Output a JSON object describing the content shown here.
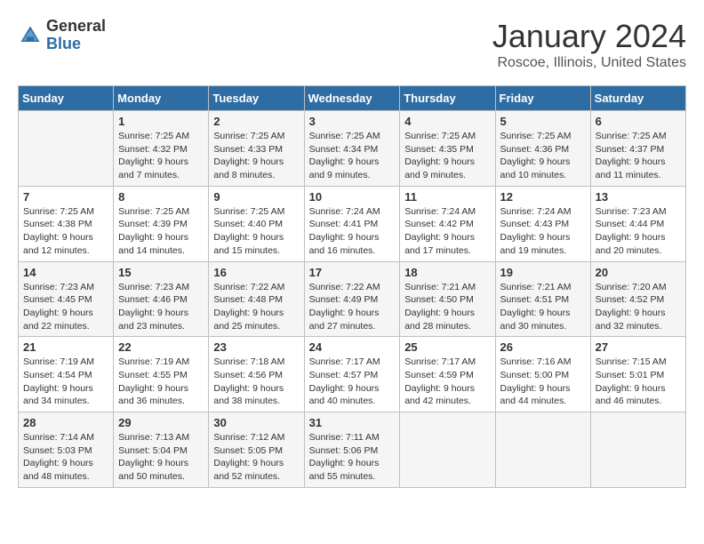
{
  "header": {
    "logo_general": "General",
    "logo_blue": "Blue",
    "title": "January 2024",
    "location": "Roscoe, Illinois, United States"
  },
  "days_of_week": [
    "Sunday",
    "Monday",
    "Tuesday",
    "Wednesday",
    "Thursday",
    "Friday",
    "Saturday"
  ],
  "weeks": [
    [
      {
        "num": "",
        "sunrise": "",
        "sunset": "",
        "daylight": ""
      },
      {
        "num": "1",
        "sunrise": "Sunrise: 7:25 AM",
        "sunset": "Sunset: 4:32 PM",
        "daylight": "Daylight: 9 hours and 7 minutes."
      },
      {
        "num": "2",
        "sunrise": "Sunrise: 7:25 AM",
        "sunset": "Sunset: 4:33 PM",
        "daylight": "Daylight: 9 hours and 8 minutes."
      },
      {
        "num": "3",
        "sunrise": "Sunrise: 7:25 AM",
        "sunset": "Sunset: 4:34 PM",
        "daylight": "Daylight: 9 hours and 9 minutes."
      },
      {
        "num": "4",
        "sunrise": "Sunrise: 7:25 AM",
        "sunset": "Sunset: 4:35 PM",
        "daylight": "Daylight: 9 hours and 9 minutes."
      },
      {
        "num": "5",
        "sunrise": "Sunrise: 7:25 AM",
        "sunset": "Sunset: 4:36 PM",
        "daylight": "Daylight: 9 hours and 10 minutes."
      },
      {
        "num": "6",
        "sunrise": "Sunrise: 7:25 AM",
        "sunset": "Sunset: 4:37 PM",
        "daylight": "Daylight: 9 hours and 11 minutes."
      }
    ],
    [
      {
        "num": "7",
        "sunrise": "Sunrise: 7:25 AM",
        "sunset": "Sunset: 4:38 PM",
        "daylight": "Daylight: 9 hours and 12 minutes."
      },
      {
        "num": "8",
        "sunrise": "Sunrise: 7:25 AM",
        "sunset": "Sunset: 4:39 PM",
        "daylight": "Daylight: 9 hours and 14 minutes."
      },
      {
        "num": "9",
        "sunrise": "Sunrise: 7:25 AM",
        "sunset": "Sunset: 4:40 PM",
        "daylight": "Daylight: 9 hours and 15 minutes."
      },
      {
        "num": "10",
        "sunrise": "Sunrise: 7:24 AM",
        "sunset": "Sunset: 4:41 PM",
        "daylight": "Daylight: 9 hours and 16 minutes."
      },
      {
        "num": "11",
        "sunrise": "Sunrise: 7:24 AM",
        "sunset": "Sunset: 4:42 PM",
        "daylight": "Daylight: 9 hours and 17 minutes."
      },
      {
        "num": "12",
        "sunrise": "Sunrise: 7:24 AM",
        "sunset": "Sunset: 4:43 PM",
        "daylight": "Daylight: 9 hours and 19 minutes."
      },
      {
        "num": "13",
        "sunrise": "Sunrise: 7:23 AM",
        "sunset": "Sunset: 4:44 PM",
        "daylight": "Daylight: 9 hours and 20 minutes."
      }
    ],
    [
      {
        "num": "14",
        "sunrise": "Sunrise: 7:23 AM",
        "sunset": "Sunset: 4:45 PM",
        "daylight": "Daylight: 9 hours and 22 minutes."
      },
      {
        "num": "15",
        "sunrise": "Sunrise: 7:23 AM",
        "sunset": "Sunset: 4:46 PM",
        "daylight": "Daylight: 9 hours and 23 minutes."
      },
      {
        "num": "16",
        "sunrise": "Sunrise: 7:22 AM",
        "sunset": "Sunset: 4:48 PM",
        "daylight": "Daylight: 9 hours and 25 minutes."
      },
      {
        "num": "17",
        "sunrise": "Sunrise: 7:22 AM",
        "sunset": "Sunset: 4:49 PM",
        "daylight": "Daylight: 9 hours and 27 minutes."
      },
      {
        "num": "18",
        "sunrise": "Sunrise: 7:21 AM",
        "sunset": "Sunset: 4:50 PM",
        "daylight": "Daylight: 9 hours and 28 minutes."
      },
      {
        "num": "19",
        "sunrise": "Sunrise: 7:21 AM",
        "sunset": "Sunset: 4:51 PM",
        "daylight": "Daylight: 9 hours and 30 minutes."
      },
      {
        "num": "20",
        "sunrise": "Sunrise: 7:20 AM",
        "sunset": "Sunset: 4:52 PM",
        "daylight": "Daylight: 9 hours and 32 minutes."
      }
    ],
    [
      {
        "num": "21",
        "sunrise": "Sunrise: 7:19 AM",
        "sunset": "Sunset: 4:54 PM",
        "daylight": "Daylight: 9 hours and 34 minutes."
      },
      {
        "num": "22",
        "sunrise": "Sunrise: 7:19 AM",
        "sunset": "Sunset: 4:55 PM",
        "daylight": "Daylight: 9 hours and 36 minutes."
      },
      {
        "num": "23",
        "sunrise": "Sunrise: 7:18 AM",
        "sunset": "Sunset: 4:56 PM",
        "daylight": "Daylight: 9 hours and 38 minutes."
      },
      {
        "num": "24",
        "sunrise": "Sunrise: 7:17 AM",
        "sunset": "Sunset: 4:57 PM",
        "daylight": "Daylight: 9 hours and 40 minutes."
      },
      {
        "num": "25",
        "sunrise": "Sunrise: 7:17 AM",
        "sunset": "Sunset: 4:59 PM",
        "daylight": "Daylight: 9 hours and 42 minutes."
      },
      {
        "num": "26",
        "sunrise": "Sunrise: 7:16 AM",
        "sunset": "Sunset: 5:00 PM",
        "daylight": "Daylight: 9 hours and 44 minutes."
      },
      {
        "num": "27",
        "sunrise": "Sunrise: 7:15 AM",
        "sunset": "Sunset: 5:01 PM",
        "daylight": "Daylight: 9 hours and 46 minutes."
      }
    ],
    [
      {
        "num": "28",
        "sunrise": "Sunrise: 7:14 AM",
        "sunset": "Sunset: 5:03 PM",
        "daylight": "Daylight: 9 hours and 48 minutes."
      },
      {
        "num": "29",
        "sunrise": "Sunrise: 7:13 AM",
        "sunset": "Sunset: 5:04 PM",
        "daylight": "Daylight: 9 hours and 50 minutes."
      },
      {
        "num": "30",
        "sunrise": "Sunrise: 7:12 AM",
        "sunset": "Sunset: 5:05 PM",
        "daylight": "Daylight: 9 hours and 52 minutes."
      },
      {
        "num": "31",
        "sunrise": "Sunrise: 7:11 AM",
        "sunset": "Sunset: 5:06 PM",
        "daylight": "Daylight: 9 hours and 55 minutes."
      },
      {
        "num": "",
        "sunrise": "",
        "sunset": "",
        "daylight": ""
      },
      {
        "num": "",
        "sunrise": "",
        "sunset": "",
        "daylight": ""
      },
      {
        "num": "",
        "sunrise": "",
        "sunset": "",
        "daylight": ""
      }
    ]
  ]
}
